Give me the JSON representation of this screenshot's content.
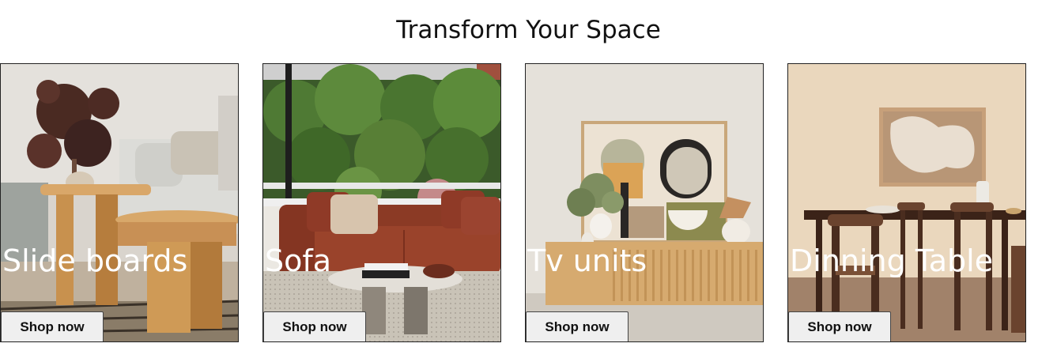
{
  "page": {
    "title": "Transform Your Space"
  },
  "cards": [
    {
      "title": "Slide boards",
      "button": "Shop now",
      "image": "sideboard-living-room-image"
    },
    {
      "title": "Sofa",
      "button": "Shop now",
      "image": "sofa-garden-window-image"
    },
    {
      "title": "Tv units",
      "button": "Shop now",
      "image": "tv-unit-artwork-image"
    },
    {
      "title": "Dinning Table",
      "button": "Shop now",
      "image": "dining-table-image"
    }
  ]
}
